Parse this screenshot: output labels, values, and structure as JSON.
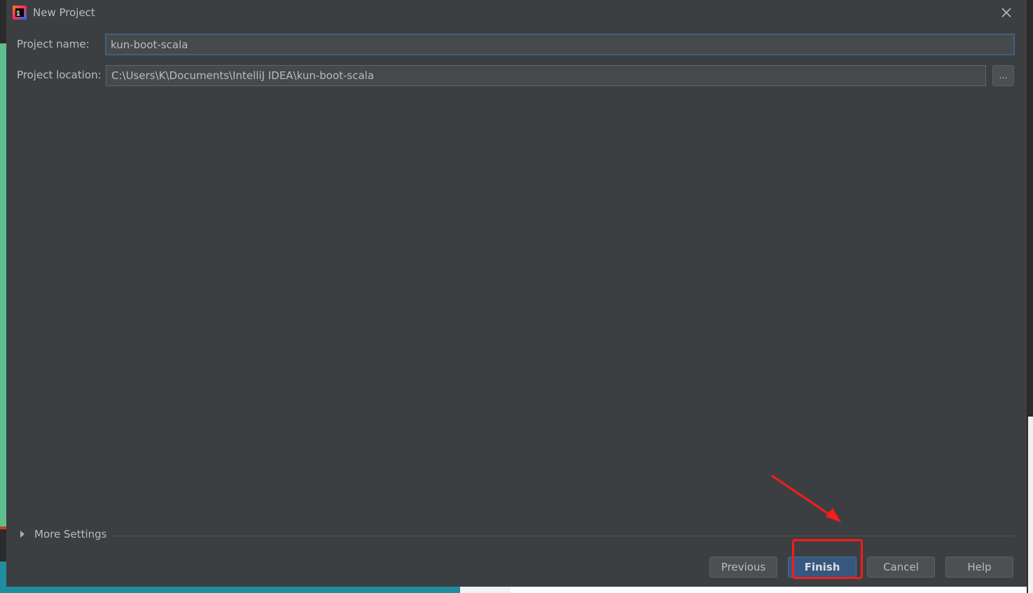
{
  "dialog": {
    "title": "New Project",
    "close_icon": "close-icon",
    "app_icon": "intellij-idea-icon"
  },
  "form": {
    "project_name_label": "Project name:",
    "project_name_value": "kun-boot-scala",
    "project_location_label": "Project location:",
    "project_location_value": "C:\\Users\\K\\Documents\\IntelliJ IDEA\\kun-boot-scala",
    "browse_label": "..."
  },
  "more_settings": {
    "label": "More Settings",
    "icon": "expand-triangle-icon"
  },
  "buttons": {
    "previous": "Previous",
    "finish": "Finish",
    "cancel": "Cancel",
    "help": "Help"
  },
  "annotation": {
    "highlight_color": "#ff1a1a"
  },
  "colors": {
    "dialog_bg": "#3c3f41",
    "field_bg": "#45494a",
    "focus_border": "#3d6185",
    "default_button": "#365880",
    "text": "#bbbbbb"
  }
}
